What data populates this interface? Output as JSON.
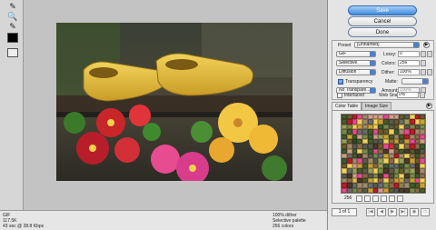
{
  "toolbar": {
    "tools": [
      "slice-select-icon",
      "zoom-icon",
      "eyedropper-icon"
    ],
    "eyedropper_color": "#000000"
  },
  "buttons": {
    "save": "Save",
    "cancel": "Cancel",
    "done": "Done"
  },
  "settings": {
    "preset_label": "Preset",
    "preset_value": "[Unnamed]",
    "format": "GIF",
    "lossy_label": "Lossy:",
    "lossy_value": "0",
    "reduction": "Selective",
    "colors_label": "Colors:",
    "colors_value": "256",
    "dither_algo": "Diffusion",
    "dither_label": "Dither:",
    "dither_value": "100%",
    "transparency_label": "Transparency",
    "transparency_checked": true,
    "matte_label": "Matte:",
    "matte_value": "",
    "transparency_dither": "No Transpare...",
    "amount_label": "Amount:",
    "amount_value": "100%",
    "interlaced_label": "Interlaced",
    "interlaced_checked": false,
    "websnap_label": "Web Snap:",
    "websnap_value": "0%"
  },
  "tabs": [
    {
      "label": "Color Table",
      "active": true
    },
    {
      "label": "Image Size",
      "active": false
    }
  ],
  "color_table": {
    "count": "256"
  },
  "pager": {
    "page": "1 of 1"
  },
  "status": {
    "format": "GIF",
    "size": "117.5K",
    "time": "43 sec @ 28.8 Kbps",
    "dither": "100% dither",
    "palette": "Selective palette",
    "colors": "256 colors"
  },
  "accent_color": "#3d8ae0"
}
